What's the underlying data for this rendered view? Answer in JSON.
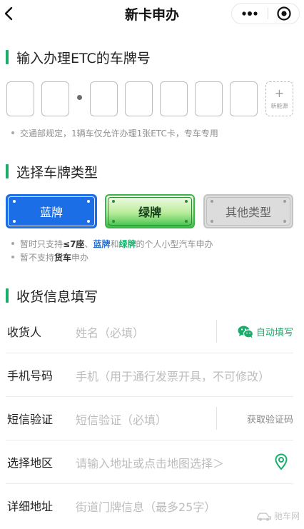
{
  "nav": {
    "title": "新卡申办"
  },
  "plate_section": {
    "title": "输入办理ETC的车牌号",
    "new_energy_plus": "+",
    "new_energy_label": "新能源",
    "note": "交通部规定，1辆车仅允许办理1张ETC卡，专车专用"
  },
  "type_section": {
    "title": "选择车牌类型",
    "types": [
      {
        "label": "蓝牌",
        "selected": true
      },
      {
        "label": "绿牌",
        "selected": false
      },
      {
        "label": "其他类型",
        "selected": false
      }
    ],
    "note1": {
      "prefix": "暂时只支持",
      "seats": "≤7座",
      "sep1": "、",
      "blue": "蓝牌",
      "mid": "和",
      "green": "绿牌",
      "suffix": "的个人小型汽车申办"
    },
    "note2": {
      "prefix": "暂不支持",
      "truck": "货车",
      "suffix": "申办"
    }
  },
  "receive_section": {
    "title": "收货信息填写",
    "fields": [
      {
        "label": "收货人",
        "placeholder": "姓名（必填）",
        "action": "自动填写"
      },
      {
        "label": "手机号码",
        "placeholder": "手机（用于通行发票开具，不可修改）"
      },
      {
        "label": "短信验证",
        "placeholder": "短信验证（必填）",
        "action": "获取验证码"
      },
      {
        "label": "选择地区",
        "placeholder": "请输入地址或点击地图选择＞"
      },
      {
        "label": "详细地址",
        "placeholder": "街道门牌信息（最多25字）"
      }
    ]
  },
  "watermark": {
    "text": "驰车网"
  },
  "colors": {
    "accent_green": "#1aad6a",
    "plate_blue": "#1b6ee6",
    "plate_green": "#3cc04a",
    "plate_other": "#dcdcdc"
  },
  "icons": {
    "back": "chevron-left-icon",
    "more": "more-dots-icon",
    "close": "target-close-icon",
    "wechat": "wechat-icon",
    "location": "location-pin-icon"
  }
}
